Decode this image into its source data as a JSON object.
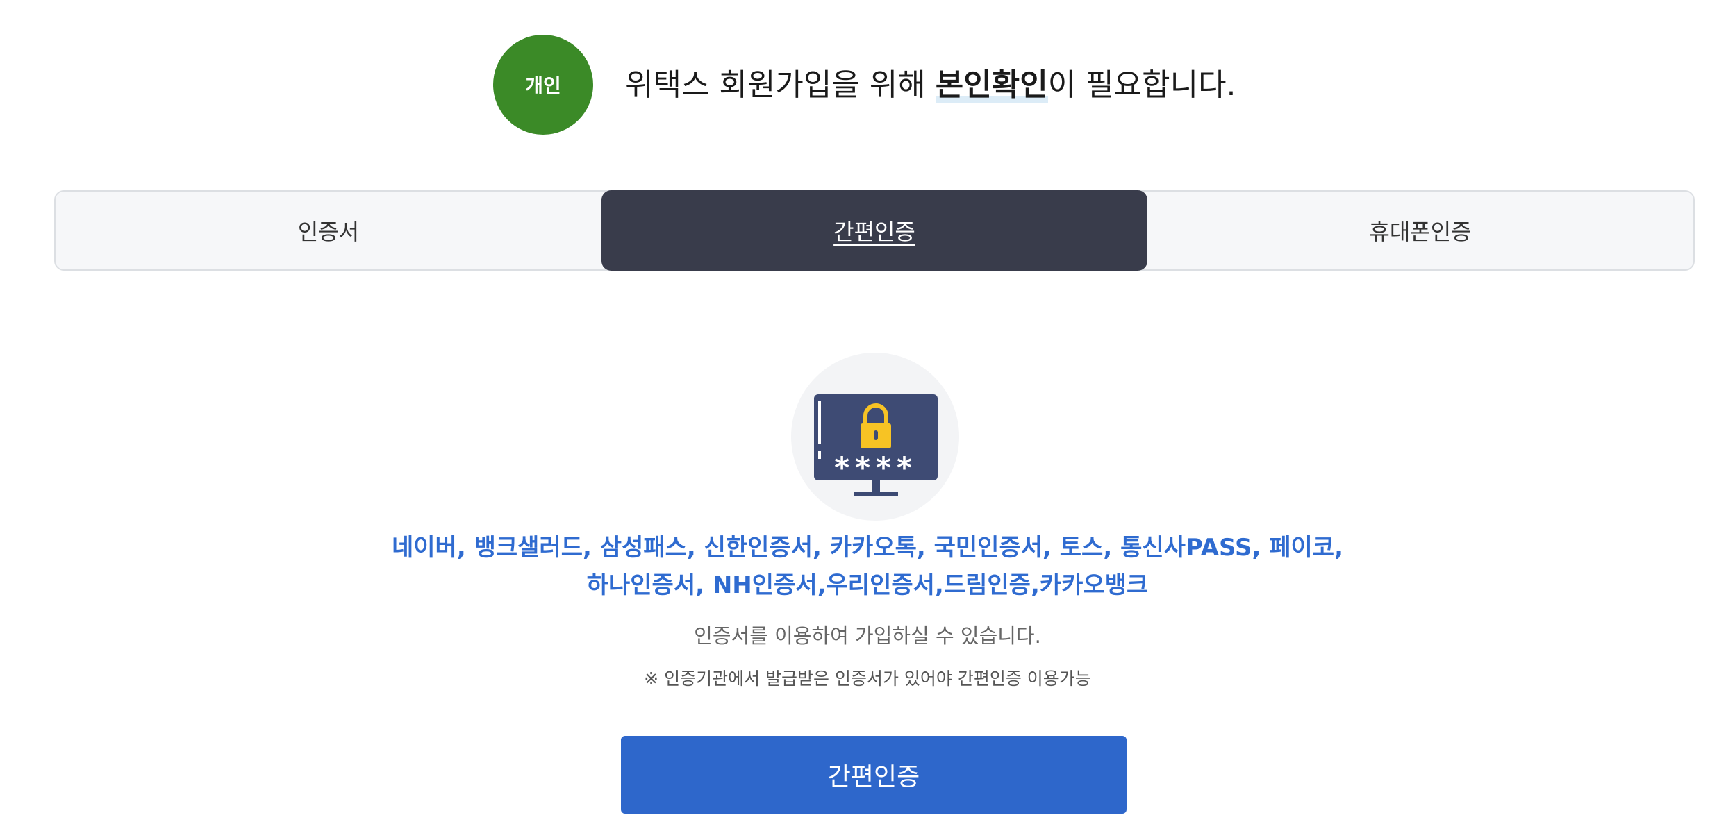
{
  "header": {
    "badge": "개인",
    "title_prefix": "위택스 회원가입을 위해 ",
    "title_highlight": "본인확인",
    "title_suffix": "이 필요합니다."
  },
  "tabs": [
    {
      "label": "인증서",
      "active": false
    },
    {
      "label": "간편인증",
      "active": true
    },
    {
      "label": "휴대폰인증",
      "active": false
    }
  ],
  "illustration": {
    "icon": "monitor-lock-password-icon",
    "password_mask": "****"
  },
  "providers": {
    "line1": "네이버, 뱅크샐러드, 삼성패스, 신한인증서, 카카오톡, 국민인증서, 토스, 통신사PASS, 페이코,",
    "line2": "하나인증서, NH인증서,우리인증서,드림인증,카카오뱅크"
  },
  "description": "인증서를 이용하여 가입하실 수 있습니다.",
  "note": "※ 인증기관에서 발급받은 인증서가 있어야 간편인증 이용가능",
  "action_button": "간편인증",
  "colors": {
    "badge": "#3b8a27",
    "active_tab": "#393c4b",
    "provider_text": "#2f6bd0",
    "button": "#2e67cb"
  }
}
